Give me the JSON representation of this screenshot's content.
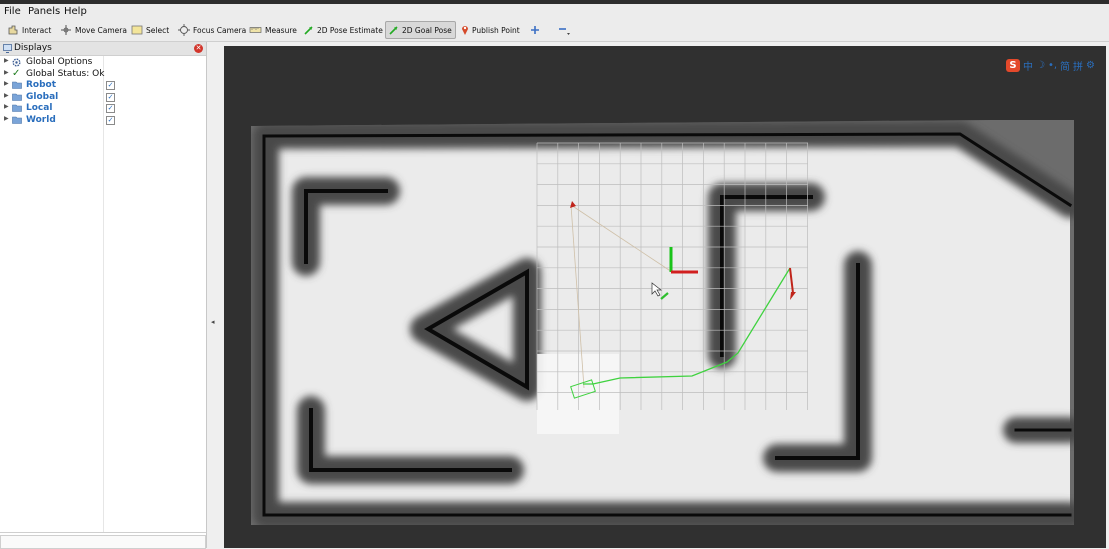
{
  "menu": [
    "File",
    "Panels",
    "Help"
  ],
  "toolbar": {
    "interact": "Interact",
    "move_camera": "Move Camera",
    "select": "Select",
    "focus_camera": "Focus Camera",
    "measure": "Measure",
    "pose_estimate": "2D Pose Estimate",
    "goal_pose": "2D Goal Pose",
    "publish_point": "Publish Point"
  },
  "displays": {
    "title": "Displays",
    "items": [
      {
        "label": "Global Options",
        "checked": null
      },
      {
        "label": "Global Status: Ok",
        "checked": null
      },
      {
        "label": "Robot",
        "checked": true
      },
      {
        "label": "Global",
        "checked": true
      },
      {
        "label": "Local",
        "checked": true
      },
      {
        "label": "World",
        "checked": true
      }
    ]
  },
  "ime": {
    "lang": "中",
    "simplified": "简",
    "pinyin": "拼"
  },
  "colors": {
    "path": "#3fd23f",
    "goal_arrow": "#c0241a",
    "axis_x": "#d11f1f",
    "axis_y": "#19c319",
    "map_free": "#ebebeb",
    "map_unknown": "#303030",
    "wall": "#0a0a0a"
  }
}
